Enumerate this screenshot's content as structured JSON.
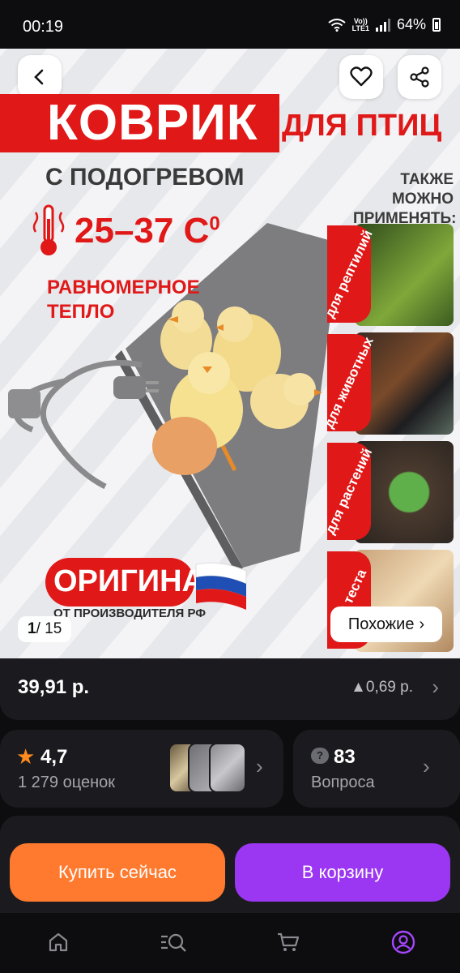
{
  "status_bar": {
    "time": "00:19",
    "network": "Vo))\nLTE1",
    "battery": "64%"
  },
  "hero": {
    "title_main": "КОВРИК",
    "title_sub": "ДЛЯ ПТИЦ",
    "heated": "С ПОДОГРЕВОМ",
    "temperature": "25–37 С",
    "temperature_degree": "0",
    "even_heat_line1": "РАВНОМЕРНОЕ",
    "even_heat_line2": "ТЕПЛО",
    "also_line1": "ТАКЖЕ МОЖНО",
    "also_line2": "ПРИМЕНЯТЬ:",
    "tags": [
      "для рептилий",
      "для животных",
      "для растений",
      "для теста"
    ],
    "original": "ОРИГИНАЛ",
    "original_sub": "ОТ ПРОИЗВОДИТЕЛЯ РФ",
    "counter_current": "1",
    "counter_total": "/ 15",
    "similar_label": "Похожие"
  },
  "price": {
    "value": "39,91 р.",
    "delta": "0,69 р."
  },
  "rating": {
    "value": "4,7",
    "count": "1 279 оценок"
  },
  "questions": {
    "value": "83",
    "label": "Вопроса"
  },
  "actions": {
    "buy_now": "Купить сейчас",
    "add_to_cart": "В корзину"
  },
  "colors": {
    "accent_red": "#e01818",
    "buy": "#ff7a2e",
    "cart": "#9b36f2",
    "star": "#ff8a1d"
  },
  "nav": [
    "home-icon",
    "catalog-search-icon",
    "cart-icon",
    "profile-icon"
  ]
}
